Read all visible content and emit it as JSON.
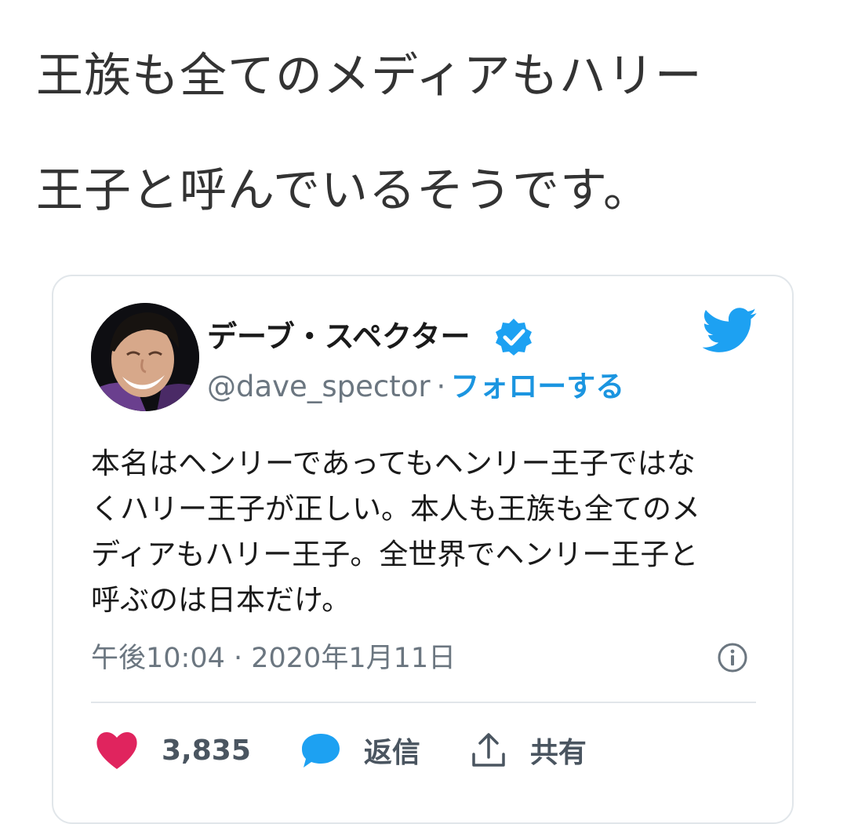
{
  "headline": "王族も全てのメディアもハリー\n王子と呼んでいるそうです。",
  "tweet": {
    "author": {
      "name": "デーブ・スペクター",
      "handle": "@dave_spector",
      "separator": "·",
      "follow_label": "フォローする",
      "verified": true
    },
    "text": "本名はヘンリーであってもヘンリー王子ではな\nくハリー王子が正しい。本人も王族も全てのメ\nディアもハリー王子。全世界でヘンリー王子と\n呼ぶのは日本だけ。",
    "timestamp": "午後10:04 · 2020年1月11日",
    "actions": {
      "like_count": "3,835",
      "reply_label": "返信",
      "share_label": "共有"
    }
  },
  "colors": {
    "twitter_blue": "#1da1f2",
    "link_blue": "#1b95e0",
    "like_pink": "#e0245e",
    "secondary_text": "#6b7680",
    "border": "#e1e6ea"
  },
  "icons": {
    "verified": "verified-badge-icon",
    "brand": "twitter-bird-icon",
    "info": "info-icon",
    "like": "heart-icon",
    "reply": "reply-bubble-icon",
    "share": "share-upload-icon"
  }
}
